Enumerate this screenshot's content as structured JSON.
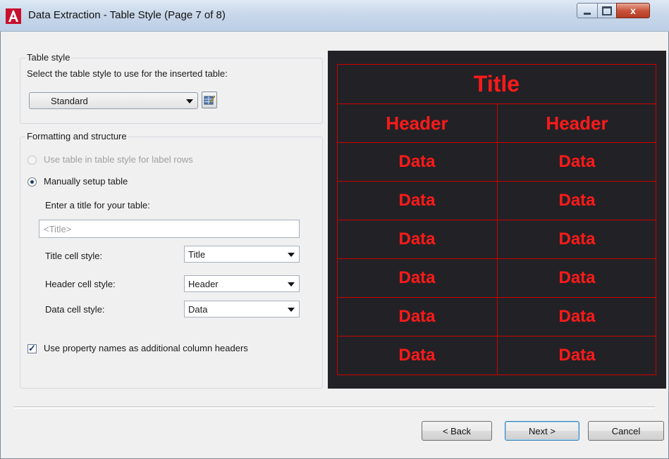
{
  "window": {
    "title": "Data Extraction - Table Style (Page 7 of 8)",
    "close_label": "x"
  },
  "table_style": {
    "group_label": "Table style",
    "prompt": "Select the table style to use for the inserted table:",
    "selected": "Standard"
  },
  "formatting": {
    "group_label": "Formatting and structure",
    "option_label_rows": "Use table in table style for label rows",
    "option_manual": "Manually setup table",
    "title_prompt": "Enter a title for your table:",
    "title_placeholder": "<Title>",
    "title_cell_label": "Title cell style:",
    "title_cell_value": "Title",
    "header_cell_label": "Header cell style:",
    "header_cell_value": "Header",
    "data_cell_label": "Data cell style:",
    "data_cell_value": "Data",
    "use_property_names": "Use property names as additional column headers"
  },
  "preview": {
    "title": "Title",
    "headers": [
      "Header",
      "Header"
    ],
    "rows": [
      [
        "Data",
        "Data"
      ],
      [
        "Data",
        "Data"
      ],
      [
        "Data",
        "Data"
      ],
      [
        "Data",
        "Data"
      ],
      [
        "Data",
        "Data"
      ],
      [
        "Data",
        "Data"
      ]
    ]
  },
  "buttons": {
    "back": "< Back",
    "next": "Next >",
    "cancel": "Cancel"
  }
}
